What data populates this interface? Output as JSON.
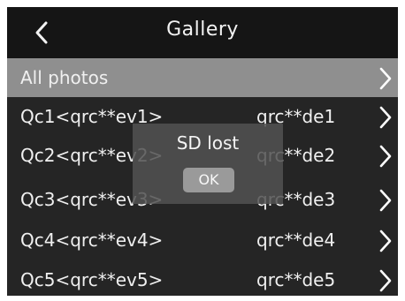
{
  "header": {
    "title": "Gallery",
    "back_icon": "chevron-left-icon"
  },
  "list": {
    "selected_index": 0,
    "items": [
      {
        "label": "All photos",
        "sub": ""
      },
      {
        "label": "Qc1<qrc**ev1>",
        "sub": "qrc**de1"
      },
      {
        "label": "Qc2<qrc**ev2>",
        "sub": "qrc**de2"
      },
      {
        "label": "Qc3<qrc**ev3>",
        "sub": "qrc**de3"
      },
      {
        "label": "Qc4<qrc**ev4>",
        "sub": "qrc**de4"
      },
      {
        "label": "Qc5<qrc**ev5>",
        "sub": "qrc**de5"
      }
    ],
    "row_icon": "chevron-right-icon"
  },
  "dialog": {
    "message": "SD lost",
    "ok_label": "OK"
  },
  "colors": {
    "background": "#252525",
    "header": "#151515",
    "selected_row": "#8f8f8f",
    "dialog": "#525252",
    "ok_button": "#9a9a9a",
    "text": "#f0f0f0"
  }
}
